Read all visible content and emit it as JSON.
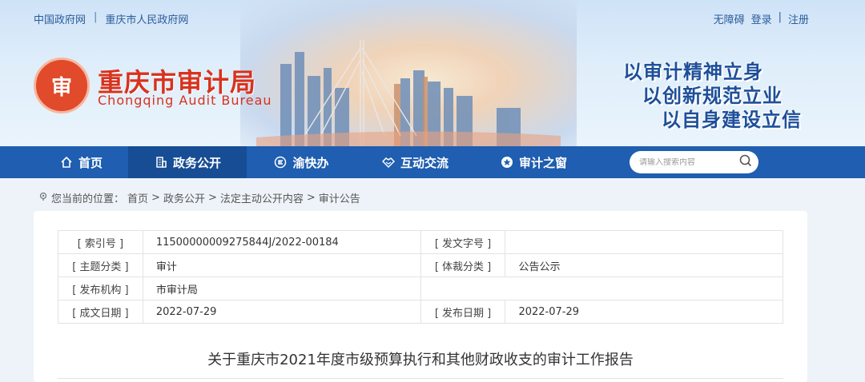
{
  "top_links": [
    "中国政府网",
    "重庆市人民政府网"
  ],
  "top_sep": "|",
  "user_links": [
    "无障碍",
    "登录",
    "|",
    "注册"
  ],
  "site": {
    "logo_char": "审",
    "title": "重庆市审计局",
    "subtitle": "Chongqing Audit Bureau"
  },
  "slogans": [
    "以审计精神立身",
    "以创新规范立业",
    "以自身建设立信"
  ],
  "nav": {
    "items": [
      {
        "label": "首页",
        "icon": "home-icon"
      },
      {
        "label": "政务公开",
        "icon": "building-icon",
        "active": true
      },
      {
        "label": "渝快办",
        "icon": "circle-e-icon"
      },
      {
        "label": "互动交流",
        "icon": "handshake-icon"
      },
      {
        "label": "审计之窗",
        "icon": "star-icon"
      }
    ],
    "search_placeholder": "请输入搜索内容"
  },
  "breadcrumb": {
    "prefix": "您当前的位置：",
    "items": [
      "首页",
      "政务公开",
      "法定主动公开内容",
      "审计公告"
    ],
    "sep": ">"
  },
  "meta": {
    "index_label": "[ 索引号 ]",
    "index_value": "11500000009275844J/2022-00184",
    "docno_label": "[ 发文字号 ]",
    "docno_value": "",
    "topic_label": "[ 主题分类 ]",
    "topic_value": "审计",
    "genre_label": "[ 体裁分类 ]",
    "genre_value": "公告公示",
    "org_label": "[ 发布机构 ]",
    "org_value": "市审计局",
    "written_label": "[ 成文日期 ]",
    "written_value": "2022-07-29",
    "publish_label": "[ 发布日期 ]",
    "publish_value": "2022-07-29"
  },
  "article_title": "关于重庆市2021年度市级预算执行和其他财政收支的审计工作报告",
  "colors": {
    "nav_bg": "#1f5eb0",
    "nav_active": "#174d94",
    "title_red": "#d8321e",
    "slogan_blue": "#1e4f9a"
  }
}
